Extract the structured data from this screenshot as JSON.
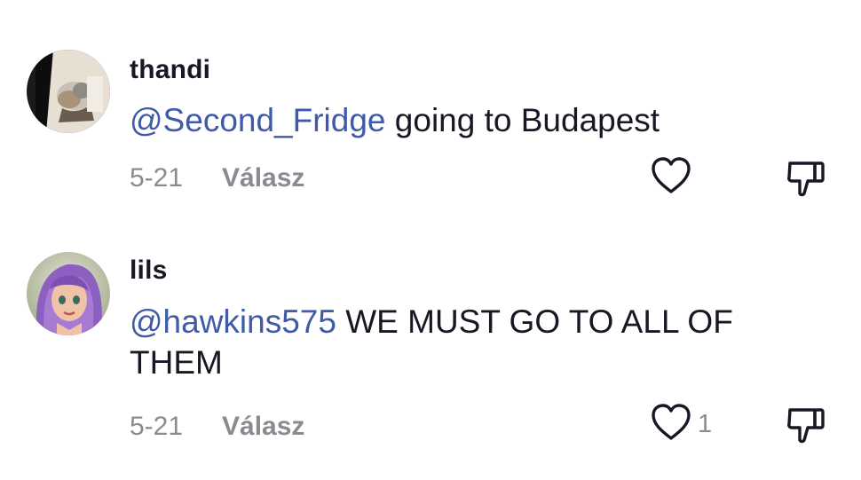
{
  "comments": [
    {
      "username": "thandi",
      "mention": "@Second_Fridge",
      "text": " going to Budapest",
      "date": "5-21",
      "reply_label": "Válasz",
      "like_count": "",
      "icons": {
        "like": "heart-icon",
        "dislike": "thumbs-down-icon"
      }
    },
    {
      "username": "lils",
      "mention": "@hawkins575",
      "text": " WE MUST GO TO ALL OF THEM",
      "date": "5-21",
      "reply_label": "Válasz",
      "like_count": "1",
      "icons": {
        "like": "heart-icon",
        "dislike": "thumbs-down-icon"
      }
    }
  ],
  "colors": {
    "mention": "#3e5aa8",
    "secondary_text": "#8a8b91",
    "primary_text": "#161823"
  }
}
